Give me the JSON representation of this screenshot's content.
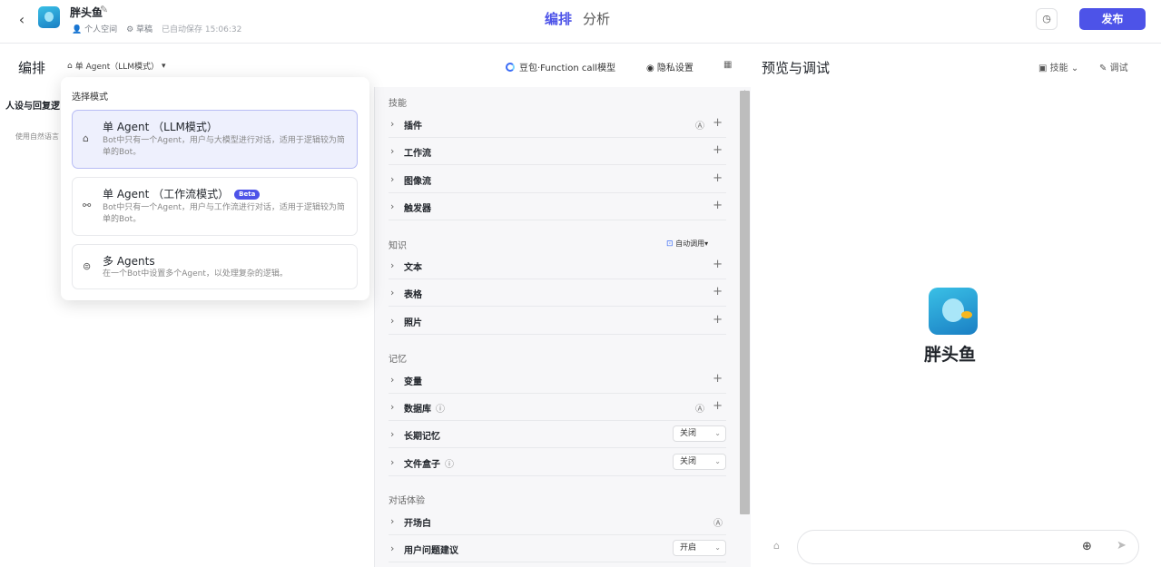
{
  "header": {
    "bot_name": "胖头鱼",
    "space": "个人空间",
    "draft": "草稿",
    "saved": "已自动保存 15:06:32",
    "tabs": [
      "编排",
      "分析"
    ],
    "publish_label": "发布"
  },
  "arrange": {
    "title": "编排",
    "mode_select": "单 Agent（LLM模式）",
    "model": "豆包·Function call模型",
    "privacy": "隐私设置"
  },
  "preview": {
    "title": "预览与调试",
    "skills": "技能",
    "debug": "调试",
    "bot_name": "胖头鱼"
  },
  "persona": {
    "title": "人设与回复逻",
    "hint": "使用自然语言"
  },
  "mode_dropdown": {
    "title": "选择模式",
    "options": [
      {
        "name": "单 Agent （LLM模式）",
        "desc": "Bot中只有一个Agent，用户与大模型进行对话，适用于逻辑较为简单的Bot。"
      },
      {
        "name": "单 Agent （工作流模式）",
        "badge": "Beta",
        "desc": "Bot中只有一个Agent，用户与工作流进行对话，适用于逻辑较为简单的Bot。"
      },
      {
        "name": "多 Agents",
        "desc": "在一个Bot中设置多个Agent，以处理复杂的逻辑。"
      }
    ]
  },
  "skills": {
    "label": "技能",
    "items": [
      "插件",
      "工作流",
      "图像流",
      "触发器"
    ]
  },
  "knowledge": {
    "label": "知识",
    "auto_call": "自动调用",
    "items": [
      "文本",
      "表格",
      "照片"
    ]
  },
  "memory": {
    "label": "记忆",
    "items": [
      "变量",
      "数据库",
      "长期记忆",
      "文件盒子"
    ],
    "long_term_value": "关闭",
    "file_box_value": "关闭"
  },
  "dialog": {
    "label": "对话体验",
    "items": [
      "开场白",
      "用户问题建议"
    ],
    "suggest_value": "开启"
  },
  "colors": {
    "accent": "#4d53e8"
  }
}
